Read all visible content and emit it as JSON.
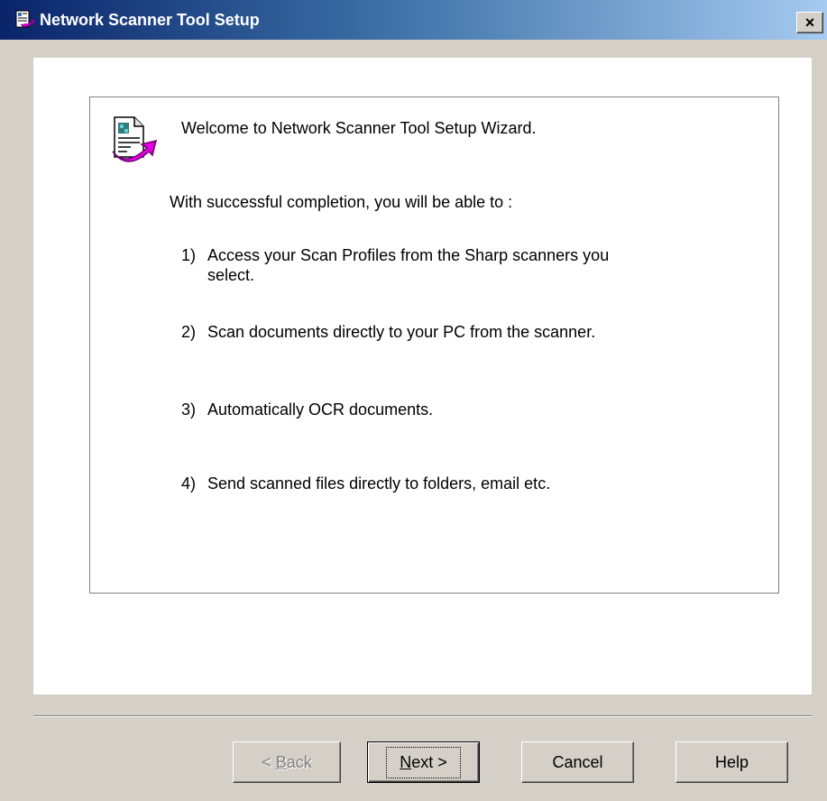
{
  "window": {
    "title": "Network Scanner Tool Setup",
    "close_label": "×"
  },
  "content": {
    "welcome": "Welcome to Network Scanner Tool Setup Wizard.",
    "intro": "With successful completion, you will be able to :",
    "items": [
      {
        "num": "1)",
        "text": "Access your Scan Profiles from the Sharp scanners you select."
      },
      {
        "num": "2)",
        "text": "Scan documents directly to your PC from the scanner."
      },
      {
        "num": "3)",
        "text": "Automatically OCR documents."
      },
      {
        "num": "4)",
        "text": "Send scanned files directly to folders, email etc."
      }
    ]
  },
  "buttons": {
    "back": {
      "prefix": "< ",
      "mnemonic": "B",
      "rest": "ack",
      "enabled": false
    },
    "next": {
      "mnemonic": "N",
      "rest": "ext >",
      "default": true
    },
    "cancel": "Cancel",
    "help": "Help"
  },
  "icons": {
    "title_icon": "setup-document-icon",
    "wizard_icon": "setup-wizard-document-arrow-icon"
  },
  "colors": {
    "titlebar_start": "#0a246a",
    "titlebar_end": "#a6caf0",
    "dialog_face": "#d4d0c8",
    "arrow_magenta": "#cc00cc"
  }
}
